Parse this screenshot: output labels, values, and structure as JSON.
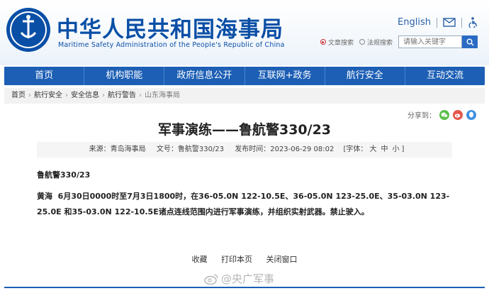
{
  "header": {
    "logo_text": "CHINA MSA",
    "title_cn": "中华人民共和国海事局",
    "title_en": "Maritime Safety Administration of the People's Republic of China",
    "lang_label": "English",
    "search": {
      "option_article": "文章搜索",
      "option_law": "法规搜索",
      "placeholder": "请输入关键字"
    }
  },
  "nav": {
    "items": [
      "首页",
      "机构职能",
      "政府信息公开",
      "互联网+政务",
      "航行安全",
      "互动交流"
    ]
  },
  "breadcrumb": [
    "首页",
    "航行安全",
    "安全信息",
    "航行警告",
    "山东海事局"
  ],
  "share": {
    "label": "分享到："
  },
  "article": {
    "title": "军事演练——鲁航警330/23",
    "meta": {
      "source": "来源：青岛海事局",
      "doc_no": "文号：鲁航警330/23",
      "publish_time": "发布时间：2023-06-29 08:02",
      "font_label": "[字体：",
      "size_large": "大",
      "size_medium": "中",
      "size_small": "小",
      "font_close": "]"
    },
    "notice_id": "鲁航警330/23",
    "body_region": "黄海",
    "body_text": "6月30日0000时至7月3日1800时，在36-05.0N 122-10.5E、36-05.0N 123-25.0E、35-03.0N 123-25.0E 和35-03.0N 122-10.5E诸点连线范围内进行军事演练，并组织实射武器。禁止驶入。"
  },
  "actions": {
    "favorite": "收藏",
    "print": "打印本页",
    "close": "关闭窗口"
  },
  "watermark": {
    "text": "@央广军事"
  },
  "colors": {
    "brand_blue": "#1c5fb5",
    "title_blue": "#0a4fa6"
  }
}
